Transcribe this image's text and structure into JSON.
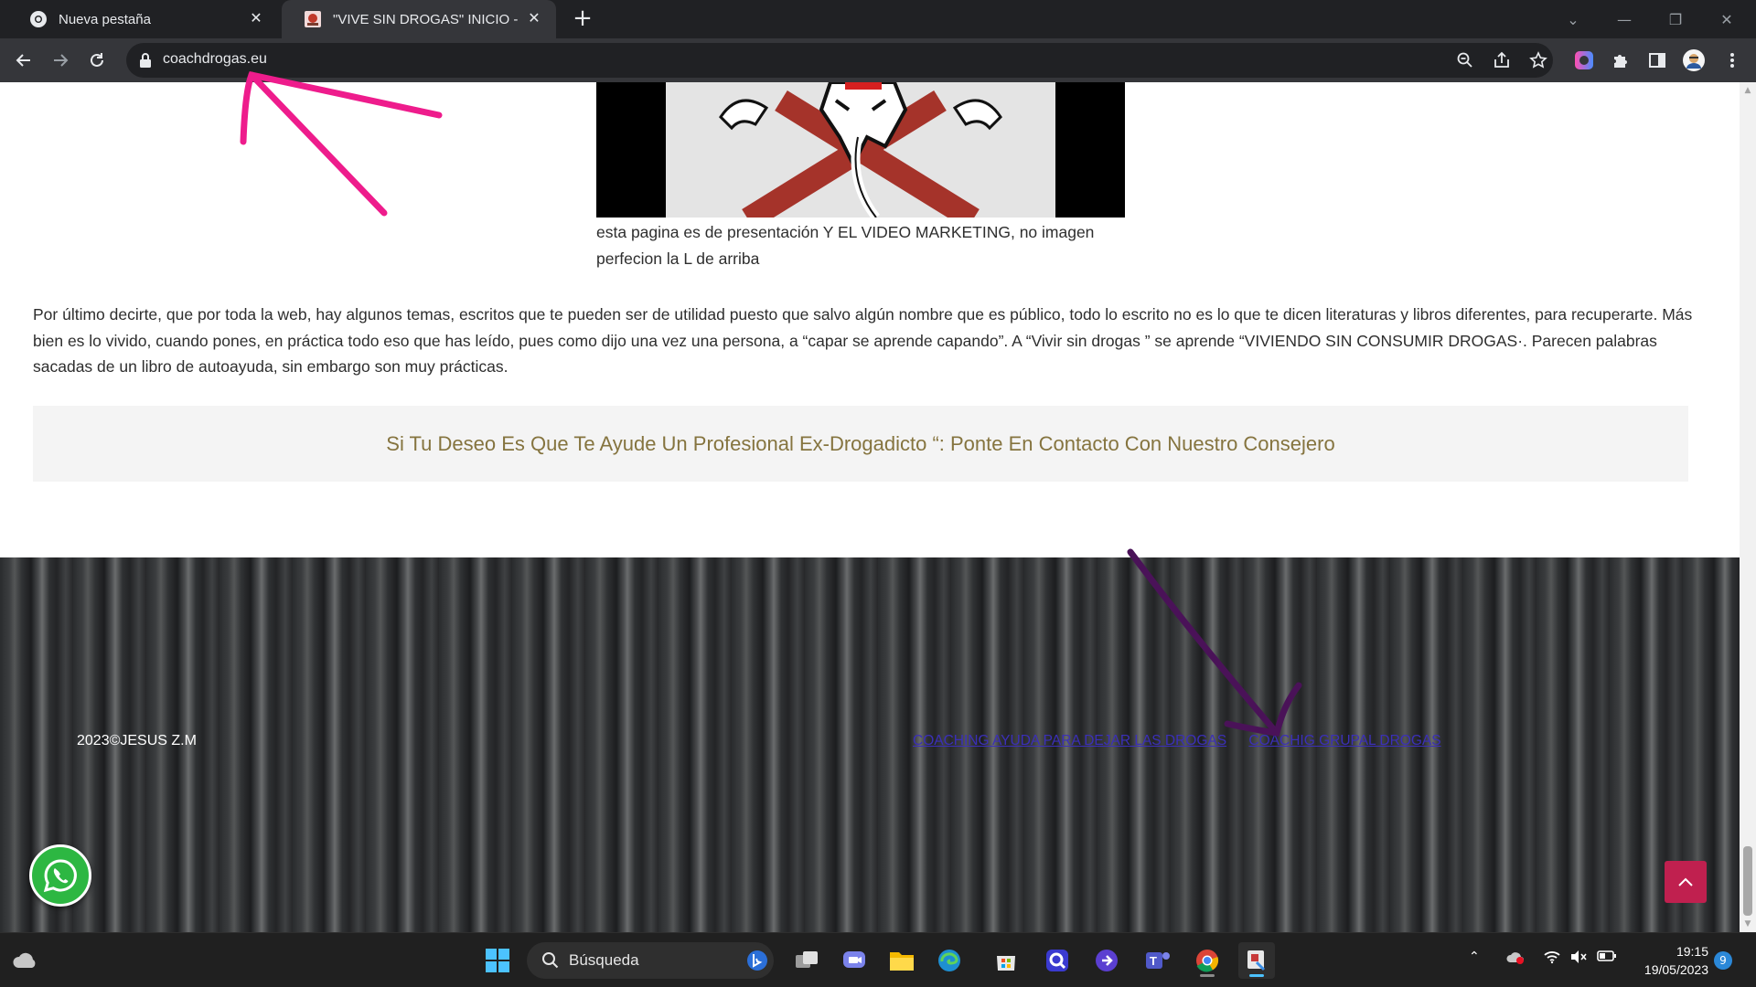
{
  "browser": {
    "tabs": [
      {
        "title": "Nueva pestaña",
        "active": false
      },
      {
        "title": "\"VIVE SIN DROGAS\" INICIO -",
        "active": true
      }
    ],
    "url": "coachdrogas.eu"
  },
  "content": {
    "caption": "esta pagina es de presentación Y EL VIDEO MARKETING, no imagen perfecion la L de arriba",
    "paragraph": "Por último decirte, que por toda la web, hay algunos temas, escritos que te pueden ser de utilidad puesto que salvo algún nombre que es público, todo lo escrito no es lo que te dicen literaturas y libros diferentes, para recuperarte. Más bien es lo vivido, cuando pones, en práctica todo eso que has leído, pues como dijo una vez una persona, a “capar se aprende capando”. A “Vivir sin drogas ” se aprende “VIVIENDO SIN CONSUMIR DROGAS·. Parecen palabras sacadas de un libro de autoayuda, sin embargo son muy prácticas.",
    "cta": "Si Tu Deseo Es Que Te Ayude Un Profesional Ex-Drogadicto “: Ponte En Contacto Con Nuestro Consejero"
  },
  "footer": {
    "copyright": "2023©JESUS Z.M",
    "links": [
      "COACHING AYUDA PARA DEJAR LAS DROGAS",
      "COACHIG GRUPAL DROGAS"
    ]
  },
  "taskbar": {
    "search_label": "Búsqueda",
    "time": "19:15",
    "date": "19/05/2023",
    "notifications": "9"
  },
  "colors": {
    "accent_cta_text": "#85743f",
    "totop_button": "#c0204f",
    "whatsapp": "#2db742",
    "annotation_pink": "#ee1c8c",
    "annotation_purple": "#4a1258"
  }
}
